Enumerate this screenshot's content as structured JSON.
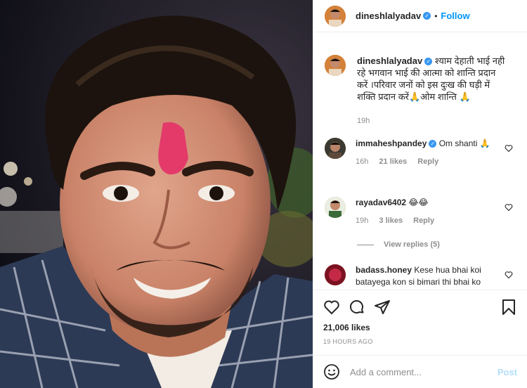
{
  "post": {
    "username": "dineshlalyadav",
    "follow_label": "Follow",
    "separator": "•"
  },
  "caption": {
    "username": "dineshlalyadav",
    "text": "श्याम देहाती भाई नही रहे भगवान भाई की आत्मा को शान्ति प्रदान करें ।परिवार जनों को इस दुःख की घड़ी में शक्ति प्रदान करें🙏ओम शान्ति 🙏",
    "time": "19h"
  },
  "comments": [
    {
      "username": "immaheshpandey",
      "text": "Om shanti 🙏",
      "time": "16h",
      "likes": "21 likes",
      "reply": "Reply"
    },
    {
      "username": "rayadav6402",
      "text": "😂😂",
      "time": "19h",
      "likes": "3 likes",
      "reply": "Reply",
      "view_replies": "View replies (5)"
    },
    {
      "username": "badass.honey",
      "text": "Kese hua bhai koi batayega kon si bimari thi bhai ko"
    }
  ],
  "actions": {
    "likes": "21,006 likes",
    "timestamp": "19 HOURS AGO"
  },
  "add_comment": {
    "placeholder": "Add a comment...",
    "post_label": "Post"
  },
  "icons": {
    "heart": "heart-icon",
    "comment": "comment-icon",
    "share": "share-icon",
    "save": "bookmark-icon",
    "emoji": "emoji-icon",
    "verified": "verified-icon"
  },
  "colors": {
    "link": "#0095f6",
    "verified": "#3897f0",
    "muted": "#8e8e8e",
    "post_disabled": "#b2dffc"
  }
}
